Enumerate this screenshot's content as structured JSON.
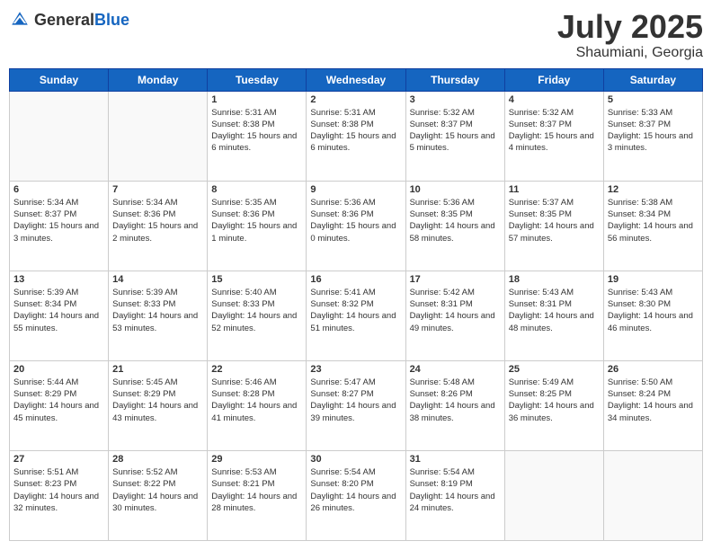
{
  "header": {
    "logo_general": "General",
    "logo_blue": "Blue",
    "month": "July 2025",
    "location": "Shaumiani, Georgia"
  },
  "weekdays": [
    "Sunday",
    "Monday",
    "Tuesday",
    "Wednesday",
    "Thursday",
    "Friday",
    "Saturday"
  ],
  "weeks": [
    [
      {
        "day": "",
        "content": ""
      },
      {
        "day": "",
        "content": ""
      },
      {
        "day": "1",
        "sunrise": "5:31 AM",
        "sunset": "8:38 PM",
        "daylight": "15 hours and 6 minutes."
      },
      {
        "day": "2",
        "sunrise": "5:31 AM",
        "sunset": "8:38 PM",
        "daylight": "15 hours and 6 minutes."
      },
      {
        "day": "3",
        "sunrise": "5:32 AM",
        "sunset": "8:37 PM",
        "daylight": "15 hours and 5 minutes."
      },
      {
        "day": "4",
        "sunrise": "5:32 AM",
        "sunset": "8:37 PM",
        "daylight": "15 hours and 4 minutes."
      },
      {
        "day": "5",
        "sunrise": "5:33 AM",
        "sunset": "8:37 PM",
        "daylight": "15 hours and 3 minutes."
      }
    ],
    [
      {
        "day": "6",
        "sunrise": "5:34 AM",
        "sunset": "8:37 PM",
        "daylight": "15 hours and 3 minutes."
      },
      {
        "day": "7",
        "sunrise": "5:34 AM",
        "sunset": "8:36 PM",
        "daylight": "15 hours and 2 minutes."
      },
      {
        "day": "8",
        "sunrise": "5:35 AM",
        "sunset": "8:36 PM",
        "daylight": "15 hours and 1 minute."
      },
      {
        "day": "9",
        "sunrise": "5:36 AM",
        "sunset": "8:36 PM",
        "daylight": "15 hours and 0 minutes."
      },
      {
        "day": "10",
        "sunrise": "5:36 AM",
        "sunset": "8:35 PM",
        "daylight": "14 hours and 58 minutes."
      },
      {
        "day": "11",
        "sunrise": "5:37 AM",
        "sunset": "8:35 PM",
        "daylight": "14 hours and 57 minutes."
      },
      {
        "day": "12",
        "sunrise": "5:38 AM",
        "sunset": "8:34 PM",
        "daylight": "14 hours and 56 minutes."
      }
    ],
    [
      {
        "day": "13",
        "sunrise": "5:39 AM",
        "sunset": "8:34 PM",
        "daylight": "14 hours and 55 minutes."
      },
      {
        "day": "14",
        "sunrise": "5:39 AM",
        "sunset": "8:33 PM",
        "daylight": "14 hours and 53 minutes."
      },
      {
        "day": "15",
        "sunrise": "5:40 AM",
        "sunset": "8:33 PM",
        "daylight": "14 hours and 52 minutes."
      },
      {
        "day": "16",
        "sunrise": "5:41 AM",
        "sunset": "8:32 PM",
        "daylight": "14 hours and 51 minutes."
      },
      {
        "day": "17",
        "sunrise": "5:42 AM",
        "sunset": "8:31 PM",
        "daylight": "14 hours and 49 minutes."
      },
      {
        "day": "18",
        "sunrise": "5:43 AM",
        "sunset": "8:31 PM",
        "daylight": "14 hours and 48 minutes."
      },
      {
        "day": "19",
        "sunrise": "5:43 AM",
        "sunset": "8:30 PM",
        "daylight": "14 hours and 46 minutes."
      }
    ],
    [
      {
        "day": "20",
        "sunrise": "5:44 AM",
        "sunset": "8:29 PM",
        "daylight": "14 hours and 45 minutes."
      },
      {
        "day": "21",
        "sunrise": "5:45 AM",
        "sunset": "8:29 PM",
        "daylight": "14 hours and 43 minutes."
      },
      {
        "day": "22",
        "sunrise": "5:46 AM",
        "sunset": "8:28 PM",
        "daylight": "14 hours and 41 minutes."
      },
      {
        "day": "23",
        "sunrise": "5:47 AM",
        "sunset": "8:27 PM",
        "daylight": "14 hours and 39 minutes."
      },
      {
        "day": "24",
        "sunrise": "5:48 AM",
        "sunset": "8:26 PM",
        "daylight": "14 hours and 38 minutes."
      },
      {
        "day": "25",
        "sunrise": "5:49 AM",
        "sunset": "8:25 PM",
        "daylight": "14 hours and 36 minutes."
      },
      {
        "day": "26",
        "sunrise": "5:50 AM",
        "sunset": "8:24 PM",
        "daylight": "14 hours and 34 minutes."
      }
    ],
    [
      {
        "day": "27",
        "sunrise": "5:51 AM",
        "sunset": "8:23 PM",
        "daylight": "14 hours and 32 minutes."
      },
      {
        "day": "28",
        "sunrise": "5:52 AM",
        "sunset": "8:22 PM",
        "daylight": "14 hours and 30 minutes."
      },
      {
        "day": "29",
        "sunrise": "5:53 AM",
        "sunset": "8:21 PM",
        "daylight": "14 hours and 28 minutes."
      },
      {
        "day": "30",
        "sunrise": "5:54 AM",
        "sunset": "8:20 PM",
        "daylight": "14 hours and 26 minutes."
      },
      {
        "day": "31",
        "sunrise": "5:54 AM",
        "sunset": "8:19 PM",
        "daylight": "14 hours and 24 minutes."
      },
      {
        "day": "",
        "content": ""
      },
      {
        "day": "",
        "content": ""
      }
    ]
  ]
}
